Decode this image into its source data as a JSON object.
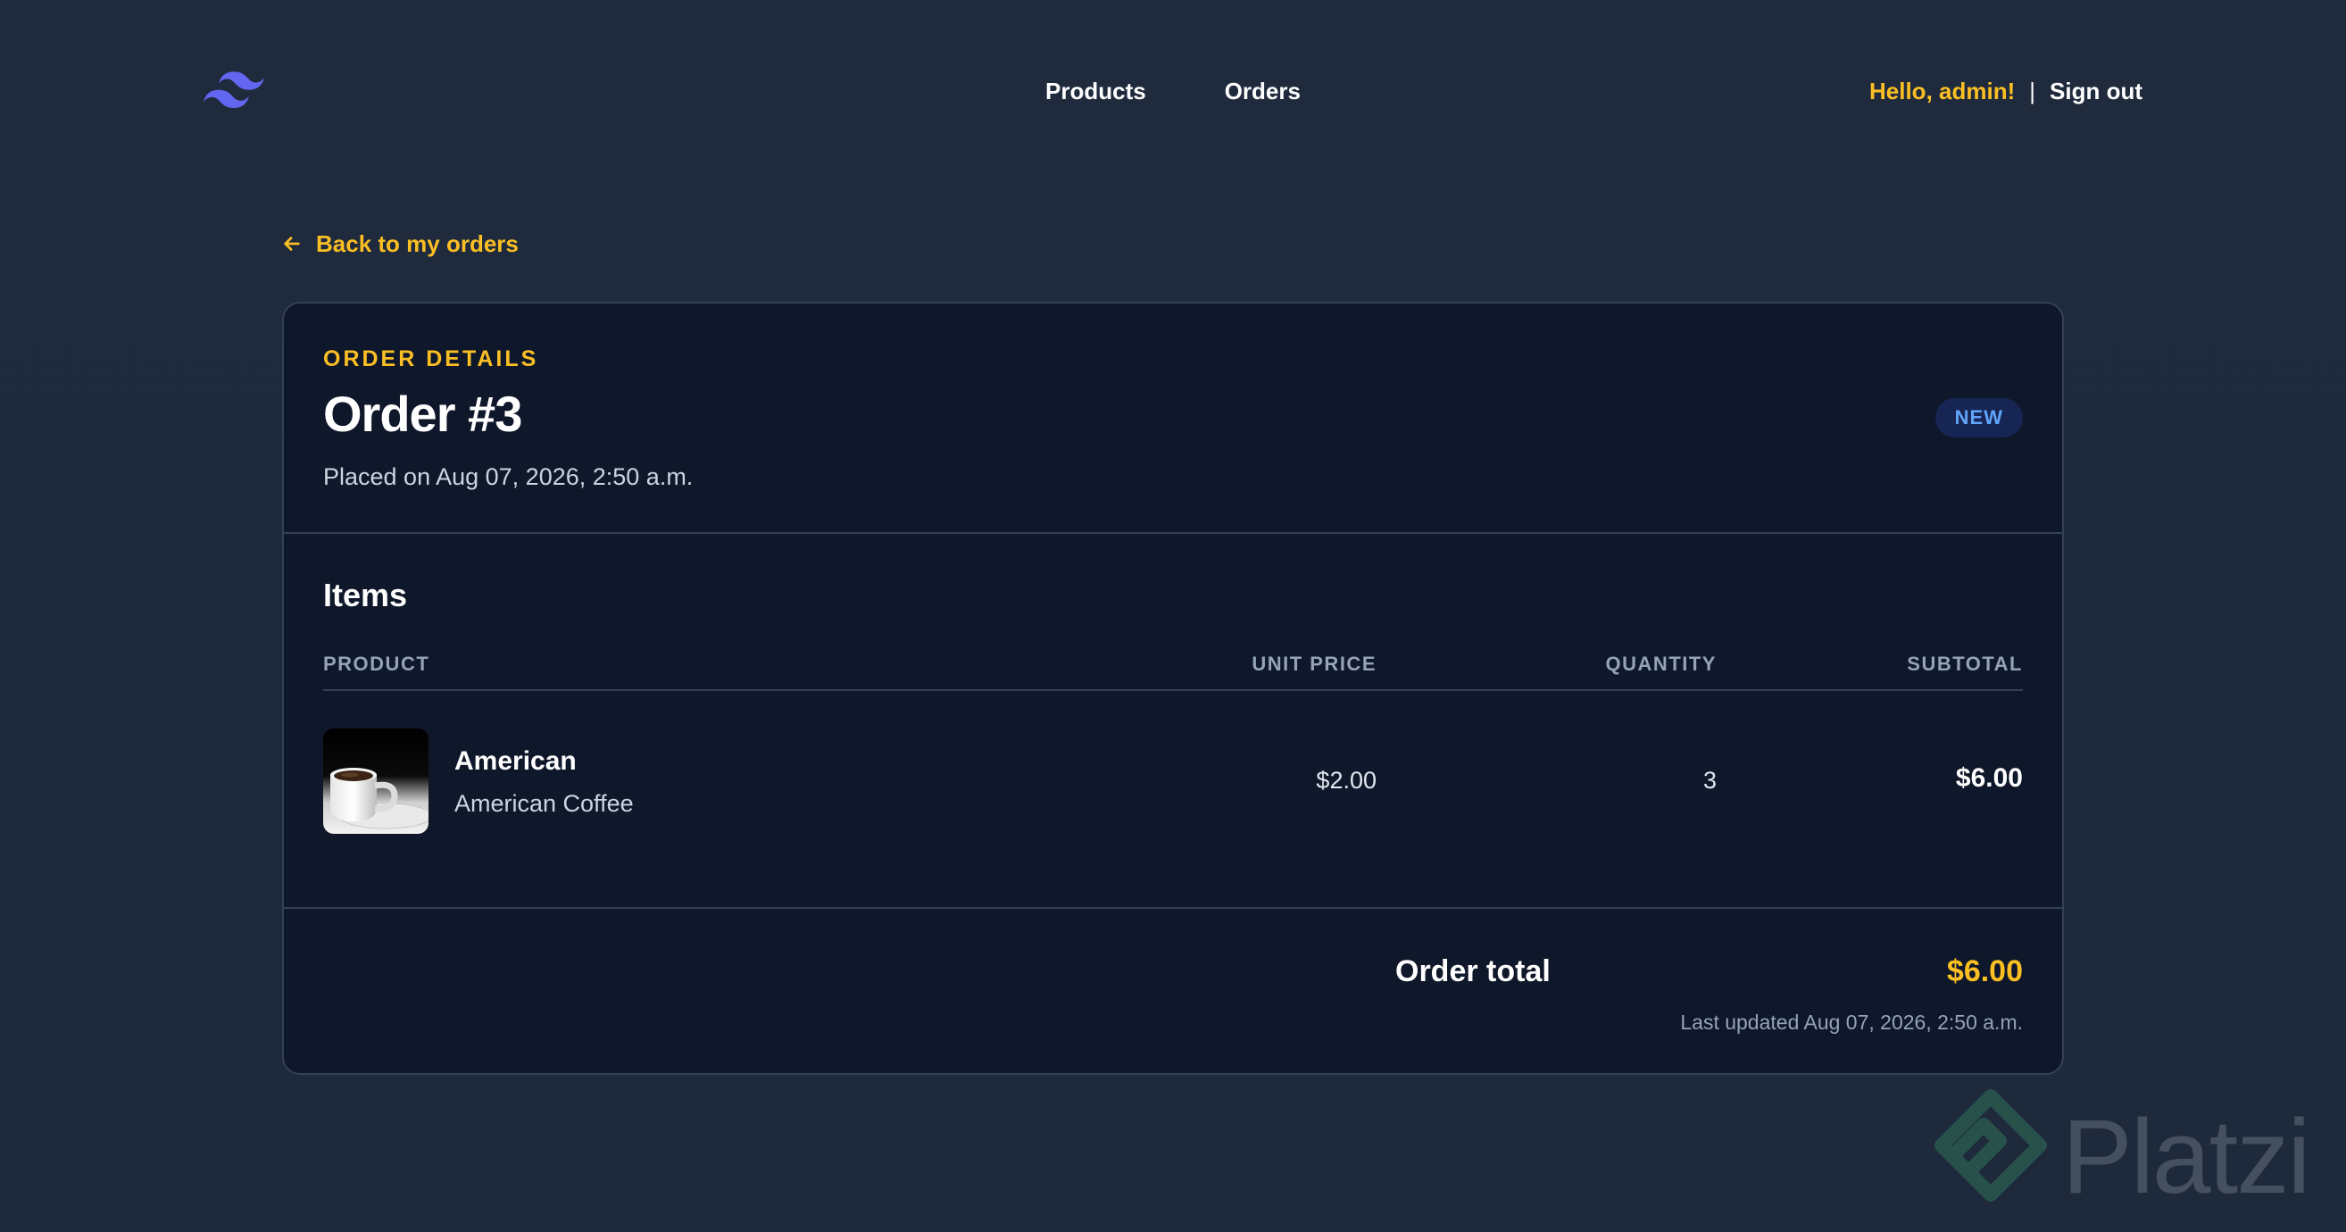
{
  "colors": {
    "background": "#1e293b",
    "card": "#0f172a",
    "accent": "#fbbf24",
    "brand": "#6366f1",
    "badge_text": "#60a5fa",
    "badge_bg": "#172554"
  },
  "header": {
    "logo_icon": "tailwind-logo-icon",
    "nav": [
      {
        "label": "Products"
      },
      {
        "label": "Orders"
      }
    ],
    "greeting": "Hello, admin!",
    "separator": "|",
    "sign_out": "Sign out"
  },
  "back_link": {
    "icon": "arrow-left-icon",
    "label": "Back to my orders"
  },
  "order": {
    "eyebrow": "ORDER DETAILS",
    "title": "Order #3",
    "placed": "Placed on Aug 07, 2026, 2:50 a.m.",
    "status": "NEW"
  },
  "items": {
    "title": "Items",
    "columns": {
      "product": "PRODUCT",
      "unit_price": "UNIT PRICE",
      "quantity": "QUANTITY",
      "subtotal": "SUBTOTAL"
    },
    "rows": [
      {
        "thumbnail_icon": "coffee-cup-image",
        "name": "American",
        "description": "American Coffee",
        "unit_price": "$2.00",
        "quantity": "3",
        "subtotal": "$6.00"
      }
    ]
  },
  "summary": {
    "total_label": "Order total",
    "total_value": "$6.00",
    "last_updated": "Last updated Aug 07, 2026, 2:50 a.m."
  },
  "watermark": {
    "text": "Platzi",
    "icon": "platzi-logo-icon"
  }
}
